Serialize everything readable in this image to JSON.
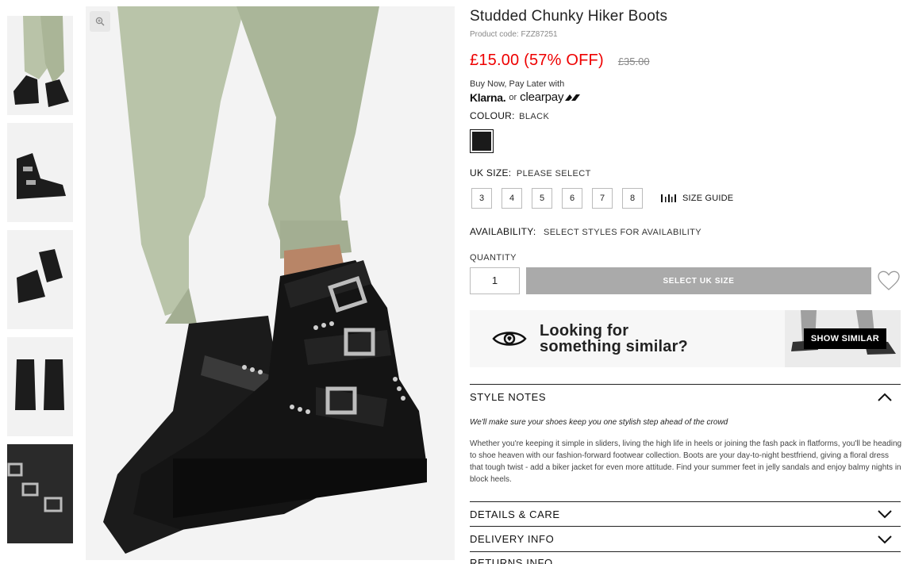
{
  "product": {
    "title": "Studded Chunky Hiker Boots",
    "code": "Product code: FZZ87251",
    "price": "£15.00 (57% OFF)",
    "old_price": "£35.00"
  },
  "payment": {
    "bnpl_text": "Buy Now, Pay Later with",
    "klarna": "Klarna.",
    "or": "or",
    "clearpay": "clearpay"
  },
  "colour": {
    "label": "COLOUR:",
    "value": "BLACK",
    "swatch": "#1a1a1a"
  },
  "size": {
    "label": "UK SIZE:",
    "value": "PLEASE SELECT",
    "options": [
      "3",
      "4",
      "5",
      "6",
      "7",
      "8"
    ],
    "guide": "SIZE GUIDE"
  },
  "availability": {
    "label": "AVAILABILITY:",
    "value": "SELECT STYLES FOR AVAILABILITY"
  },
  "quantity": {
    "label": "QUANTITY",
    "value": "1"
  },
  "add_button": "SELECT UK SIZE",
  "similar": {
    "line1": "Looking for",
    "line2": "something similar?",
    "button": "SHOW SIMILAR"
  },
  "style_notes": {
    "title": "STYLE NOTES",
    "lead": "We'll make sure your shoes keep you one stylish step ahead of the crowd",
    "body": "Whether you're keeping it simple in sliders, living the high life in heels or joining the fash pack in flatforms, you'll be heading to shoe heaven with our fashion-forward footwear collection. Boots are your day-to-night bestfriend, giving a floral dress that tough twist - add a biker jacket for even more attitude. Find your summer feet in jelly sandals and enjoy balmy nights in block heels."
  },
  "accordions": {
    "details": "DETAILS & CARE",
    "delivery": "DELIVERY INFO",
    "returns": "RETURNS INFO"
  },
  "colors": {
    "price_red": "#e00000",
    "button_grey": "#aaaaaa",
    "accent": "#000000"
  }
}
